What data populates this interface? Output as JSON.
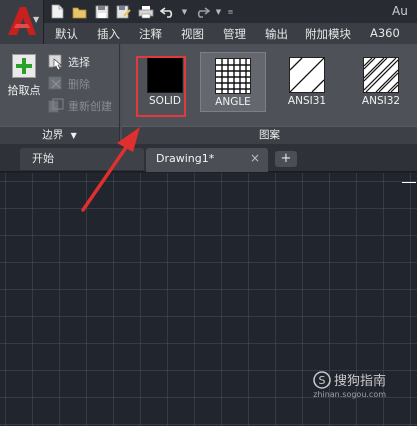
{
  "titlebar": {
    "title_text": "Au",
    "quick_access": [
      "new-icon",
      "open-icon",
      "save-icon",
      "save-as-icon",
      "print-icon",
      "undo-icon",
      "redo-icon"
    ]
  },
  "ribbon_tabs": [
    "默认",
    "插入",
    "注释",
    "视图",
    "管理",
    "输出",
    "附加模块",
    "A360"
  ],
  "boundary_panel": {
    "pick_points": "拾取点",
    "select": "选择",
    "remove": "删除",
    "recreate": "重新创建",
    "footer": "边界"
  },
  "pattern_panel": {
    "swatches": [
      "SOLID",
      "ANGLE",
      "ANSI31",
      "ANSI32"
    ],
    "footer": "图案"
  },
  "file_tabs": {
    "start": "开始",
    "drawing": "Drawing1*",
    "close_glyph": "×",
    "new_glyph": "+"
  },
  "watermark": {
    "logo_glyph": "S",
    "text": "搜狗指南",
    "url": "zhinan.sogou.com"
  },
  "colors": {
    "highlight": "#e23a3a",
    "app_logo": "#c8201e",
    "canvas": "#21252d"
  }
}
